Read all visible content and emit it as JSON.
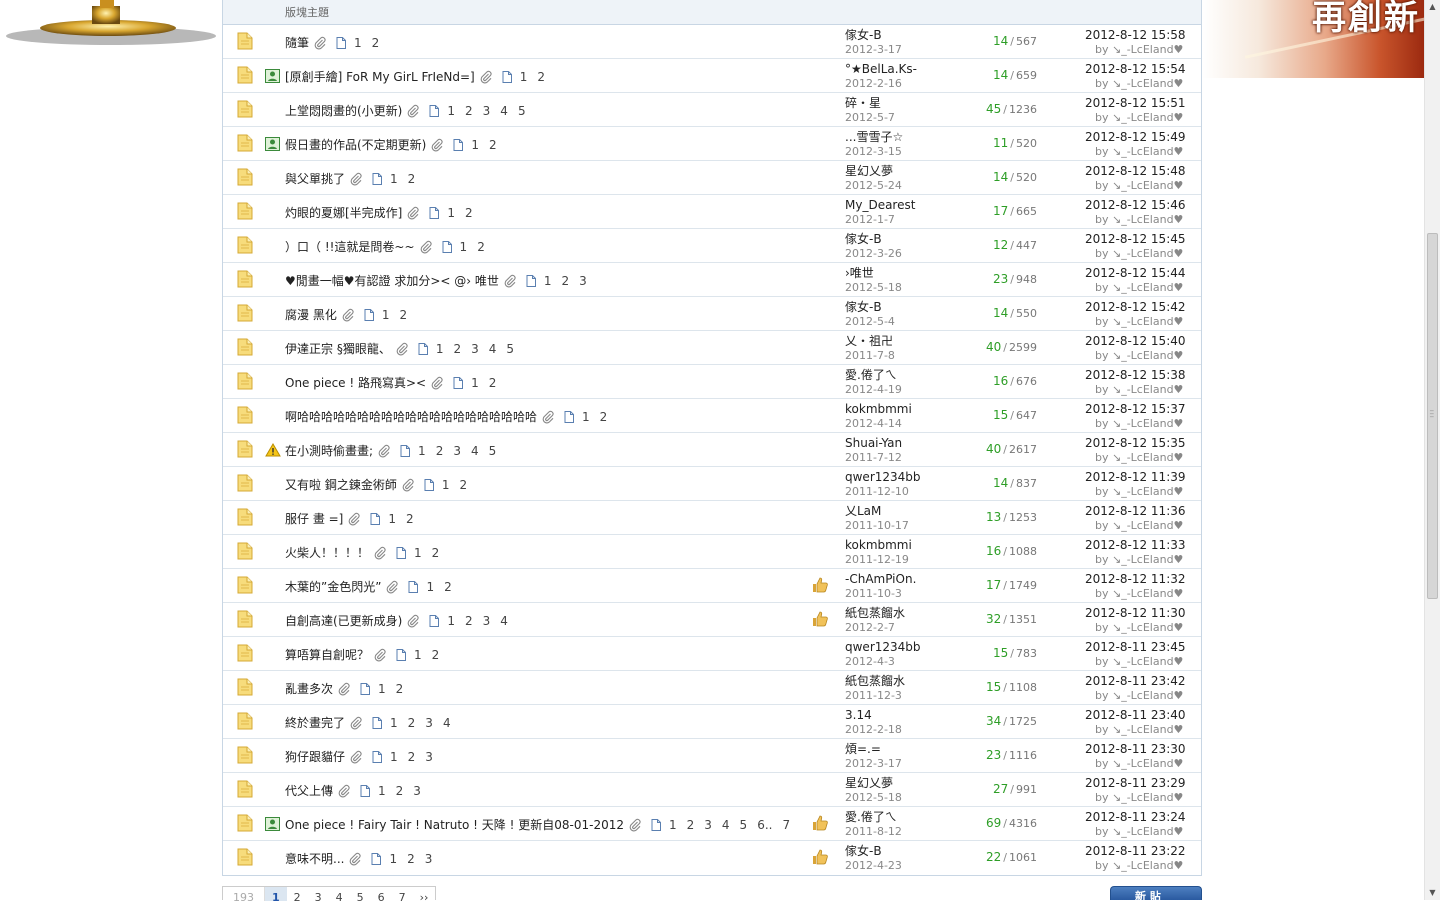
{
  "header": {
    "column_label": "版塊主題"
  },
  "banner": {
    "text": "再創新"
  },
  "threads": [
    {
      "title": "隨筆",
      "pages": [
        "1",
        "2"
      ],
      "author": "傢女-B",
      "created": "2012-3-17",
      "replies": "14",
      "views": "567",
      "last_time": "2012-8-12 15:58",
      "last_by": "by ↘_-LcEland♥"
    },
    {
      "title": "[原創手繪] FoR My GirL FrIeNd=]",
      "pages": [
        "1",
        "2"
      ],
      "author": "°★BelLa.Ks-",
      "created": "2012-2-16",
      "replies": "14",
      "views": "659",
      "last_time": "2012-8-12 15:54",
      "last_by": "by ↘_-LcEland♥"
    },
    {
      "title": "上堂悶悶畫的(小更新)",
      "pages": [
        "1",
        "2",
        "3",
        "4",
        "5"
      ],
      "author": "碎・星",
      "created": "2012-5-7",
      "replies": "45",
      "views": "1236",
      "last_time": "2012-8-12 15:51",
      "last_by": "by ↘_-LcEland♥"
    },
    {
      "title": "假日畫的作品(不定期更新)",
      "pages": [
        "1",
        "2"
      ],
      "author": "...雪雪子☆",
      "created": "2012-3-15",
      "replies": "11",
      "views": "520",
      "last_time": "2012-8-12 15:49",
      "last_by": "by ↘_-LcEland♥"
    },
    {
      "title": "與父單挑了",
      "pages": [
        "1",
        "2"
      ],
      "author": "星幻乂夢",
      "created": "2012-5-24",
      "replies": "14",
      "views": "520",
      "last_time": "2012-8-12 15:48",
      "last_by": "by ↘_-LcEland♥"
    },
    {
      "title": "灼眼的夏娜[半完成作]",
      "pages": [
        "1",
        "2"
      ],
      "author": "My_Dearest",
      "created": "2012-1-7",
      "replies": "17",
      "views": "665",
      "last_time": "2012-8-12 15:46",
      "last_by": "by ↘_-LcEland♥"
    },
    {
      "title": "）口（ !!這就是問卷~~",
      "pages": [
        "1",
        "2"
      ],
      "author": "傢女-B",
      "created": "2012-3-26",
      "replies": "12",
      "views": "447",
      "last_time": "2012-8-12 15:45",
      "last_by": "by ↘_-LcEland♥"
    },
    {
      "title": "♥閒畫一幅♥有認證 求加分>< @› 唯世",
      "pages": [
        "1",
        "2",
        "3"
      ],
      "author": "›唯世",
      "created": "2012-5-18",
      "replies": "23",
      "views": "948",
      "last_time": "2012-8-12 15:44",
      "last_by": "by ↘_-LcEland♥"
    },
    {
      "title": "腐漫 黑化",
      "pages": [
        "1",
        "2"
      ],
      "author": "傢女-B",
      "created": "2012-5-4",
      "replies": "14",
      "views": "550",
      "last_time": "2012-8-12 15:42",
      "last_by": "by ↘_-LcEland♥"
    },
    {
      "title": "伊達正宗 §獨眼龍、",
      "pages": [
        "1",
        "2",
        "3",
        "4",
        "5"
      ],
      "author": "乂・祖卍",
      "created": "2011-7-8",
      "replies": "40",
      "views": "2599",
      "last_time": "2012-8-12 15:40",
      "last_by": "by ↘_-LcEland♥"
    },
    {
      "title": "One piece ! 路飛寫真><",
      "pages": [
        "1",
        "2"
      ],
      "author": "愛.倦了ㄟ",
      "created": "2012-4-19",
      "replies": "16",
      "views": "676",
      "last_time": "2012-8-12 15:38",
      "last_by": "by ↘_-LcEland♥"
    },
    {
      "title": "啊哈哈哈哈哈哈哈哈哈哈哈哈哈哈哈哈哈哈哈哈",
      "pages": [
        "1",
        "2"
      ],
      "author": "kokmbmmi",
      "created": "2012-4-14",
      "replies": "15",
      "views": "647",
      "last_time": "2012-8-12 15:37",
      "last_by": "by ↘_-LcEland♥"
    },
    {
      "title": "在小測時偷畫畫;",
      "pages": [
        "1",
        "2",
        "3",
        "4",
        "5"
      ],
      "author": "Shuai-Yan",
      "created": "2011-7-12",
      "replies": "40",
      "views": "2617",
      "last_time": "2012-8-12 15:35",
      "last_by": "by ↘_-LcEland♥"
    },
    {
      "title": "又有啦 鋼之鍊金術師",
      "pages": [
        "1",
        "2"
      ],
      "author": "qwer1234bb",
      "created": "2011-12-10",
      "replies": "14",
      "views": "837",
      "last_time": "2012-8-12 11:39",
      "last_by": "by ↘_-LcEland♥"
    },
    {
      "title": "服仔 畫 =]",
      "pages": [
        "1",
        "2"
      ],
      "author": "乂LaM",
      "created": "2011-10-17",
      "replies": "13",
      "views": "1253",
      "last_time": "2012-8-12 11:36",
      "last_by": "by ↘_-LcEland♥"
    },
    {
      "title": "火柴人！！！！",
      "pages": [
        "1",
        "2"
      ],
      "author": "kokmbmmi",
      "created": "2011-12-19",
      "replies": "16",
      "views": "1088",
      "last_time": "2012-8-12 11:33",
      "last_by": "by ↘_-LcEland♥"
    },
    {
      "title": "木葉的”金色閃光”",
      "pages": [
        "1",
        "2"
      ],
      "author": "-ChAmPiOn.",
      "created": "2011-10-3",
      "replies": "17",
      "views": "1749",
      "last_time": "2012-8-12 11:32",
      "last_by": "by ↘_-LcEland♥"
    },
    {
      "title": "自創高達(已更新成身)",
      "pages": [
        "1",
        "2",
        "3",
        "4"
      ],
      "author": "紙包蒸餾水",
      "created": "2012-2-7",
      "replies": "32",
      "views": "1351",
      "last_time": "2012-8-12 11:30",
      "last_by": "by ↘_-LcEland♥"
    },
    {
      "title": "算唔算自創呢？",
      "pages": [
        "1",
        "2"
      ],
      "author": "qwer1234bb",
      "created": "2012-4-3",
      "replies": "15",
      "views": "783",
      "last_time": "2012-8-11 23:45",
      "last_by": "by ↘_-LcEland♥"
    },
    {
      "title": "亂畫多次",
      "pages": [
        "1",
        "2"
      ],
      "author": "紙包蒸餾水",
      "created": "2011-12-3",
      "replies": "15",
      "views": "1108",
      "last_time": "2012-8-11 23:42",
      "last_by": "by ↘_-LcEland♥"
    },
    {
      "title": "終於畫完了",
      "pages": [
        "1",
        "2",
        "3",
        "4"
      ],
      "author": "3.14",
      "created": "2012-2-18",
      "replies": "34",
      "views": "1725",
      "last_time": "2012-8-11 23:40",
      "last_by": "by ↘_-LcEland♥"
    },
    {
      "title": "狗仔跟貓仔",
      "pages": [
        "1",
        "2",
        "3"
      ],
      "author": "煩=.=",
      "created": "2012-3-17",
      "replies": "23",
      "views": "1116",
      "last_time": "2012-8-11 23:30",
      "last_by": "by ↘_-LcEland♥"
    },
    {
      "title": "代父上傳",
      "pages": [
        "1",
        "2",
        "3"
      ],
      "author": "星幻乂夢",
      "created": "2012-5-18",
      "replies": "27",
      "views": "991",
      "last_time": "2012-8-11 23:29",
      "last_by": "by ↘_-LcEland♥"
    },
    {
      "title": "One piece ! Fairy Tair ! Natruto ! 天降 ! 更新自08-01-2012",
      "pages": [
        "1",
        "2",
        "3",
        "4",
        "5",
        "6..",
        "7"
      ],
      "author": "愛.倦了ㄟ",
      "created": "2011-8-12",
      "replies": "69",
      "views": "4316",
      "last_time": "2012-8-11 23:24",
      "last_by": "by ↘_-LcEland♥"
    },
    {
      "title": "意味不明...",
      "pages": [
        "1",
        "2",
        "3"
      ],
      "author": "傢女-B",
      "created": "2012-4-23",
      "replies": "22",
      "views": "1061",
      "last_time": "2012-8-11 23:22",
      "last_by": "by ↘_-LcEland♥"
    }
  ],
  "pager": {
    "total": "193",
    "pages": [
      "1",
      "2",
      "3",
      "4",
      "5",
      "6",
      "7"
    ],
    "next": "››"
  },
  "new_post_button": {
    "label": "新 貼"
  },
  "colors": {
    "reply_count": "#2e9e27",
    "row_border": "#dde5ec",
    "header_bg": "#eef3f8",
    "folder": "#f4d36b"
  },
  "icons": {
    "folder": "folder-icon",
    "image_type": "image-thread-icon",
    "warning": "warning-icon",
    "attachment": "paperclip-icon",
    "page": "page-icon",
    "recommend": "thumbs-up-icon"
  },
  "row_flags": {
    "image_type_rows": [
      1,
      3,
      23
    ],
    "warning_rows": [
      12
    ],
    "thumb_rows": [
      16,
      17,
      23,
      24
    ]
  }
}
